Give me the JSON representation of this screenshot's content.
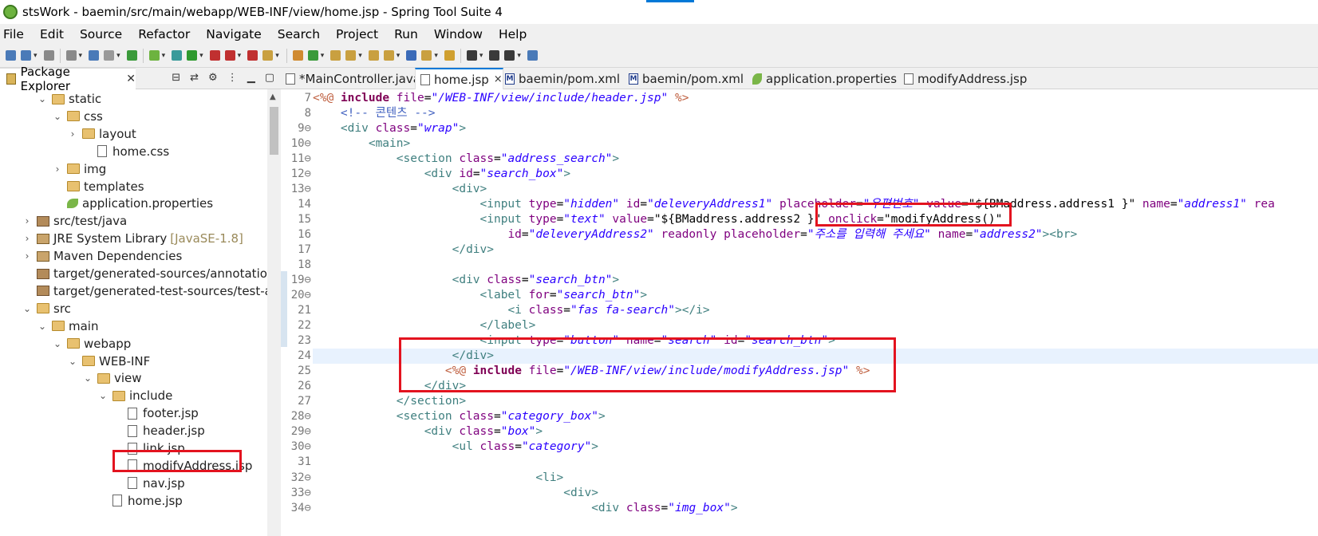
{
  "window": {
    "title": "stsWork - baemin/src/main/webapp/WEB-INF/view/home.jsp - Spring Tool Suite 4"
  },
  "menu": [
    "File",
    "Edit",
    "Source",
    "Refactor",
    "Navigate",
    "Search",
    "Project",
    "Run",
    "Window",
    "Help"
  ],
  "package_explorer": {
    "tab_label": "Package Explorer",
    "tree": [
      {
        "label": "static",
        "depth": 2,
        "expanded": true,
        "icon": "folder-icon"
      },
      {
        "label": "css",
        "depth": 3,
        "expanded": true,
        "icon": "folder-icon"
      },
      {
        "label": "layout",
        "depth": 4,
        "expanded": false,
        "icon": "folder-icon"
      },
      {
        "label": "home.css",
        "depth": 5,
        "icon": "file-icon"
      },
      {
        "label": "img",
        "depth": 3,
        "expanded": false,
        "icon": "folder-icon"
      },
      {
        "label": "templates",
        "depth": 3,
        "icon": "folder-icon"
      },
      {
        "label": "application.properties",
        "depth": 3,
        "icon": "spring-leaf-icon"
      },
      {
        "label": "src/test/java",
        "depth": 1,
        "expanded": false,
        "icon": "package-icon"
      },
      {
        "label": "JRE System Library",
        "suffix": "[JavaSE-1.8]",
        "depth": 1,
        "expanded": false,
        "icon": "library-icon"
      },
      {
        "label": "Maven Dependencies",
        "depth": 1,
        "expanded": false,
        "icon": "library-icon"
      },
      {
        "label": "target/generated-sources/annotations",
        "depth": 1,
        "icon": "package-icon"
      },
      {
        "label": "target/generated-test-sources/test-annc",
        "depth": 1,
        "icon": "package-icon"
      },
      {
        "label": "src",
        "depth": 1,
        "expanded": true,
        "icon": "folder-icon"
      },
      {
        "label": "main",
        "depth": 2,
        "expanded": true,
        "icon": "folder-icon"
      },
      {
        "label": "webapp",
        "depth": 3,
        "expanded": true,
        "icon": "folder-icon"
      },
      {
        "label": "WEB-INF",
        "depth": 4,
        "expanded": true,
        "icon": "folder-icon"
      },
      {
        "label": "view",
        "depth": 5,
        "expanded": true,
        "icon": "folder-icon"
      },
      {
        "label": "include",
        "depth": 6,
        "expanded": true,
        "icon": "folder-icon"
      },
      {
        "label": "footer.jsp",
        "depth": 7,
        "icon": "file-icon"
      },
      {
        "label": "header.jsp",
        "depth": 7,
        "icon": "file-icon"
      },
      {
        "label": "link.jsp",
        "depth": 7,
        "icon": "file-icon"
      },
      {
        "label": "modifyAddress.jsp",
        "depth": 7,
        "icon": "file-icon"
      },
      {
        "label": "nav.jsp",
        "depth": 7,
        "icon": "file-icon"
      },
      {
        "label": "home.jsp",
        "depth": 6,
        "icon": "file-icon"
      }
    ]
  },
  "editor_tabs": [
    {
      "label": "*MainController.java",
      "icon": "java-file-icon",
      "active": false
    },
    {
      "label": "home.jsp",
      "icon": "jsp-file-icon",
      "active": true,
      "close": "×"
    },
    {
      "label": "baemin/pom.xml",
      "icon": "maven-file-icon",
      "active": false
    },
    {
      "label": "baemin/pom.xml",
      "icon": "maven-file-icon",
      "active": false
    },
    {
      "label": "application.properties",
      "icon": "spring-leaf-icon",
      "active": false
    },
    {
      "label": "modifyAddress.jsp",
      "icon": "jsp-file-icon",
      "active": false
    }
  ],
  "code_lines": [
    {
      "n": "7",
      "fold": false,
      "html": "<span class=\"dir\">&lt;%@</span> <span class=\"kw\">include</span> <span class=\"at\">file</span>=<span class=\"av\">\"/WEB-INF/view/include/header.jsp\"</span> <span class=\"dir\">%&gt;</span>"
    },
    {
      "n": "8",
      "fold": false,
      "html": "    <span class=\"cm\">&lt;!-- 콘텐츠 --&gt;</span>"
    },
    {
      "n": "9",
      "fold": true,
      "html": "    <span class=\"tag\">&lt;div</span> <span class=\"at\">class</span>=<span class=\"av\">\"wrap\"</span><span class=\"tag\">&gt;</span>"
    },
    {
      "n": "10",
      "fold": true,
      "html": "        <span class=\"tag\">&lt;main&gt;</span>"
    },
    {
      "n": "11",
      "fold": true,
      "html": "            <span class=\"tag\">&lt;section</span> <span class=\"at\">class</span>=<span class=\"av\">\"address_search\"</span><span class=\"tag\">&gt;</span>"
    },
    {
      "n": "12",
      "fold": true,
      "html": "                <span class=\"tag\">&lt;div</span> <span class=\"at\">id</span>=<span class=\"av\">\"search_box\"</span><span class=\"tag\">&gt;</span>"
    },
    {
      "n": "13",
      "fold": true,
      "html": "                    <span class=\"tag\">&lt;div&gt;</span>"
    },
    {
      "n": "14",
      "fold": false,
      "html": "                        <span class=\"tag\">&lt;input</span> <span class=\"at\">type</span>=<span class=\"av\">\"hidden\"</span> <span class=\"at\">id</span>=<span class=\"av\">\"deleveryAddress1\"</span> <span class=\"at\">placeholder</span>=<span class=\"av\">\"우편번호\"</span> <span class=\"at\">value</span>=<span class=\"bl\">\"${BMaddress.address1 }\"</span> <span class=\"at\">name</span>=<span class=\"av\">\"address1\"</span> <span class=\"at\">rea</span>"
    },
    {
      "n": "15",
      "fold": false,
      "html": "                        <span class=\"tag\">&lt;input</span> <span class=\"at\">type</span>=<span class=\"av\">\"text\"</span> <span class=\"at\">value</span>=<span class=\"bl\">\"${BMaddress.address2 }\"</span> <span class=\"at\">onclick</span>=<span class=\"bl\">\"modifyAddress()\"</span>"
    },
    {
      "n": "16",
      "fold": false,
      "html": "                            <span class=\"at\">id</span>=<span class=\"av\">\"deleveryAddress2\"</span> <span class=\"at\">readonly</span> <span class=\"at\">placeholder</span>=<span class=\"av\">\"주소를 입력해 주세요\"</span> <span class=\"at\">name</span>=<span class=\"av\">\"address2\"</span><span class=\"tag\">&gt;&lt;br&gt;</span>"
    },
    {
      "n": "17",
      "fold": false,
      "html": "                    <span class=\"tag\">&lt;/div&gt;</span>"
    },
    {
      "n": "18",
      "fold": false,
      "html": ""
    },
    {
      "n": "19",
      "fold": true,
      "html": "                    <span class=\"tag\">&lt;div</span> <span class=\"at\">class</span>=<span class=\"av\">\"search_btn\"</span><span class=\"tag\">&gt;</span>"
    },
    {
      "n": "20",
      "fold": true,
      "html": "                        <span class=\"tag\">&lt;label</span> <span class=\"at\">for</span>=<span class=\"av\">\"search_btn\"</span><span class=\"tag\">&gt;</span>"
    },
    {
      "n": "21",
      "fold": false,
      "html": "                            <span class=\"tag\">&lt;i</span> <span class=\"at\">class</span>=<span class=\"av\">\"fas fa-search\"</span><span class=\"tag\">&gt;&lt;/i&gt;</span>"
    },
    {
      "n": "22",
      "fold": false,
      "html": "                        <span class=\"tag\">&lt;/label&gt;</span>"
    },
    {
      "n": "23",
      "fold": false,
      "html": "                        <span class=\"tag\">&lt;input</span> <span class=\"at\">type</span>=<span class=\"av\">\"button\"</span> <span class=\"at\">name</span>=<span class=\"av\">\"search\"</span> <span class=\"at\">id</span>=<span class=\"av\">\"search_btn\"</span><span class=\"tag\">&gt;</span>"
    },
    {
      "n": "24",
      "fold": false,
      "hl": true,
      "html": "                    <span class=\"tag\">&lt;/div&gt;</span>"
    },
    {
      "n": "25",
      "fold": false,
      "html": "                   <span class=\"dir\">&lt;%@</span> <span class=\"kw\">include</span> <span class=\"at\">file</span>=<span class=\"av\">\"/WEB-INF/view/include/modifyAddress.jsp\"</span> <span class=\"dir\">%&gt;</span>"
    },
    {
      "n": "26",
      "fold": false,
      "html": "                <span class=\"tag\">&lt;/div&gt;</span>"
    },
    {
      "n": "27",
      "fold": false,
      "html": "            <span class=\"tag\">&lt;/section&gt;</span>"
    },
    {
      "n": "28",
      "fold": true,
      "html": "            <span class=\"tag\">&lt;section</span> <span class=\"at\">class</span>=<span class=\"av\">\"category_box\"</span><span class=\"tag\">&gt;</span>"
    },
    {
      "n": "29",
      "fold": true,
      "html": "                <span class=\"tag\">&lt;div</span> <span class=\"at\">class</span>=<span class=\"av\">\"box\"</span><span class=\"tag\">&gt;</span>"
    },
    {
      "n": "30",
      "fold": true,
      "html": "                    <span class=\"tag\">&lt;ul</span> <span class=\"at\">class</span>=<span class=\"av\">\"category\"</span><span class=\"tag\">&gt;</span>"
    },
    {
      "n": "31",
      "fold": false,
      "html": ""
    },
    {
      "n": "32",
      "fold": true,
      "html": "                                <span class=\"tag\">&lt;li&gt;</span>"
    },
    {
      "n": "33",
      "fold": true,
      "html": "                                    <span class=\"tag\">&lt;div&gt;</span>"
    },
    {
      "n": "34",
      "fold": true,
      "html": "                                        <span class=\"tag\">&lt;div</span> <span class=\"at\">class</span>=<span class=\"av\">\"img_box\"</span><span class=\"tag\">&gt;</span>"
    }
  ],
  "colors": {
    "highlight_box": "#e3131f",
    "accent": "#0078d7"
  }
}
